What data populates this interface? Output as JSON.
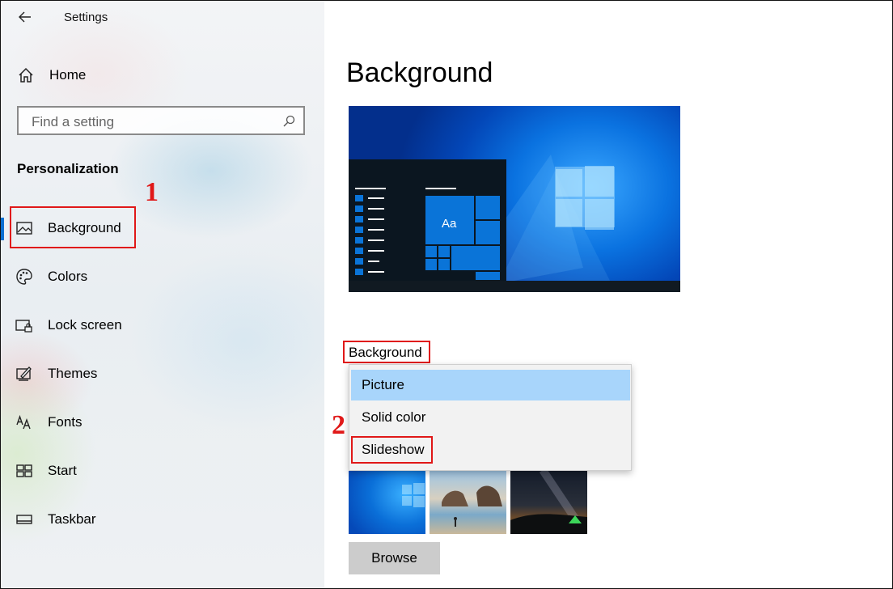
{
  "window": {
    "title": "Settings"
  },
  "sidebar": {
    "home_label": "Home",
    "search_placeholder": "Find a setting",
    "section_title": "Personalization",
    "items": [
      {
        "label": "Background",
        "icon": "picture-icon",
        "selected": true
      },
      {
        "label": "Colors",
        "icon": "palette-icon"
      },
      {
        "label": "Lock screen",
        "icon": "lock-screen-icon"
      },
      {
        "label": "Themes",
        "icon": "themes-icon"
      },
      {
        "label": "Fonts",
        "icon": "fonts-icon"
      },
      {
        "label": "Start",
        "icon": "start-icon"
      },
      {
        "label": "Taskbar",
        "icon": "taskbar-icon"
      }
    ]
  },
  "main": {
    "title": "Background",
    "preview": {
      "sample_text": "Aa"
    },
    "background_field": {
      "label": "Background",
      "options": [
        "Picture",
        "Solid color",
        "Slideshow"
      ],
      "highlighted": "Picture"
    },
    "browse_label": "Browse"
  },
  "annotations": {
    "step1": "1",
    "step2": "2"
  },
  "colors": {
    "accent": "#0a6fd1",
    "annotation": "#e01818",
    "dropdown_highlight": "#a8d5fb"
  }
}
